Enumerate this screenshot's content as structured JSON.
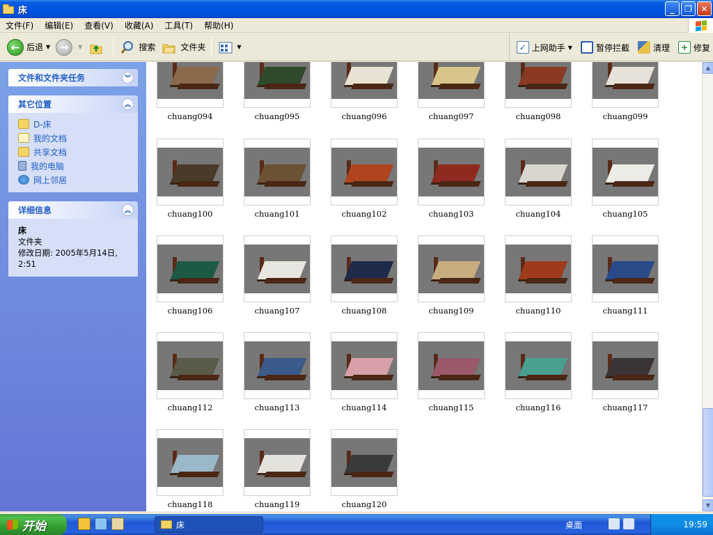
{
  "window": {
    "title": "床"
  },
  "menu": [
    "文件(F)",
    "编辑(E)",
    "查看(V)",
    "收藏(A)",
    "工具(T)",
    "帮助(H)"
  ],
  "toolbar": {
    "back": "后退",
    "search": "搜索",
    "folders": "文件夹",
    "online_helper": "上网助手",
    "popup_block": "暂停拦截",
    "clean": "清理",
    "repair": "修复"
  },
  "sidebar": {
    "tasks_title": "文件和文件夹任务",
    "places_title": "其它位置",
    "places": [
      "D-床",
      "我的文档",
      "共享文档",
      "我的电脑",
      "网上邻居"
    ],
    "details_title": "详细信息",
    "details_name": "床",
    "details_type": "文件夹",
    "details_date": "修改日期: 2005年5月14日, 2:51"
  },
  "files": [
    "chuang094",
    "chuang095",
    "chuang096",
    "chuang097",
    "chuang098",
    "chuang099",
    "chuang100",
    "chuang101",
    "chuang102",
    "chuang103",
    "chuang104",
    "chuang105",
    "chuang106",
    "chuang107",
    "chuang108",
    "chuang109",
    "chuang110",
    "chuang111",
    "chuang112",
    "chuang113",
    "chuang114",
    "chuang115",
    "chuang116",
    "chuang117",
    "chuang118",
    "chuang119",
    "chuang120"
  ],
  "bed_colors": [
    "#8a6a4a",
    "#2f4a2a",
    "#e8e2d4",
    "#d8c48a",
    "#8a3a22",
    "#e6e2da",
    "#4a3a2a",
    "#6b5234",
    "#b0441e",
    "#8e2a1e",
    "#d9d6d0",
    "#ecebe6",
    "#1d5a46",
    "#e8e6e0",
    "#1e2a4a",
    "#c8ad80",
    "#a03a1c",
    "#2a4a8a",
    "#5a5a48",
    "#3a5a8a",
    "#d8a0a8",
    "#9a5a6a",
    "#4aa090",
    "#3a3434",
    "#9ab8c8",
    "#e4e2dc",
    "#3a3a3a"
  ],
  "taskbar": {
    "start": "开始",
    "active_window": "床",
    "desktop": "桌面",
    "clock": "19:59"
  }
}
